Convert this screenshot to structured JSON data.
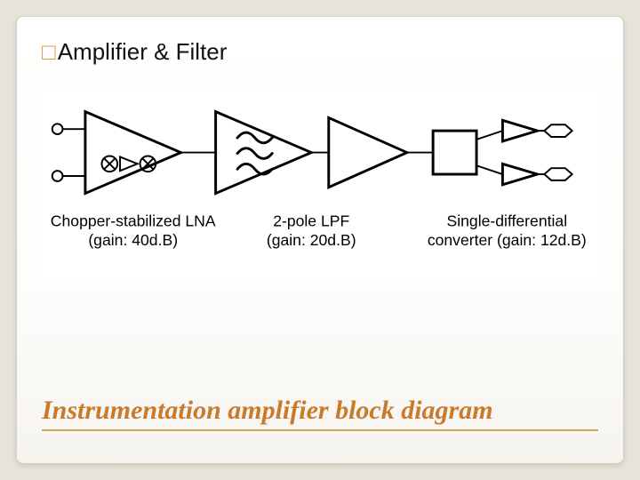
{
  "slide": {
    "bullet_glyph": "□",
    "title": "Amplifier & Filter",
    "subtitle": "Instrumentation amplifier block diagram"
  },
  "blocks": [
    {
      "id": "lna",
      "name": "Chopper-stabilized LNA",
      "gain_text": "(gain: 40d.B)"
    },
    {
      "id": "lpf",
      "name": "2-pole LPF",
      "gain_text": "(gain: 20d.B)"
    },
    {
      "id": "conv",
      "name": "Single-differential",
      "gain_text": "converter (gain: 12d.B)"
    }
  ]
}
